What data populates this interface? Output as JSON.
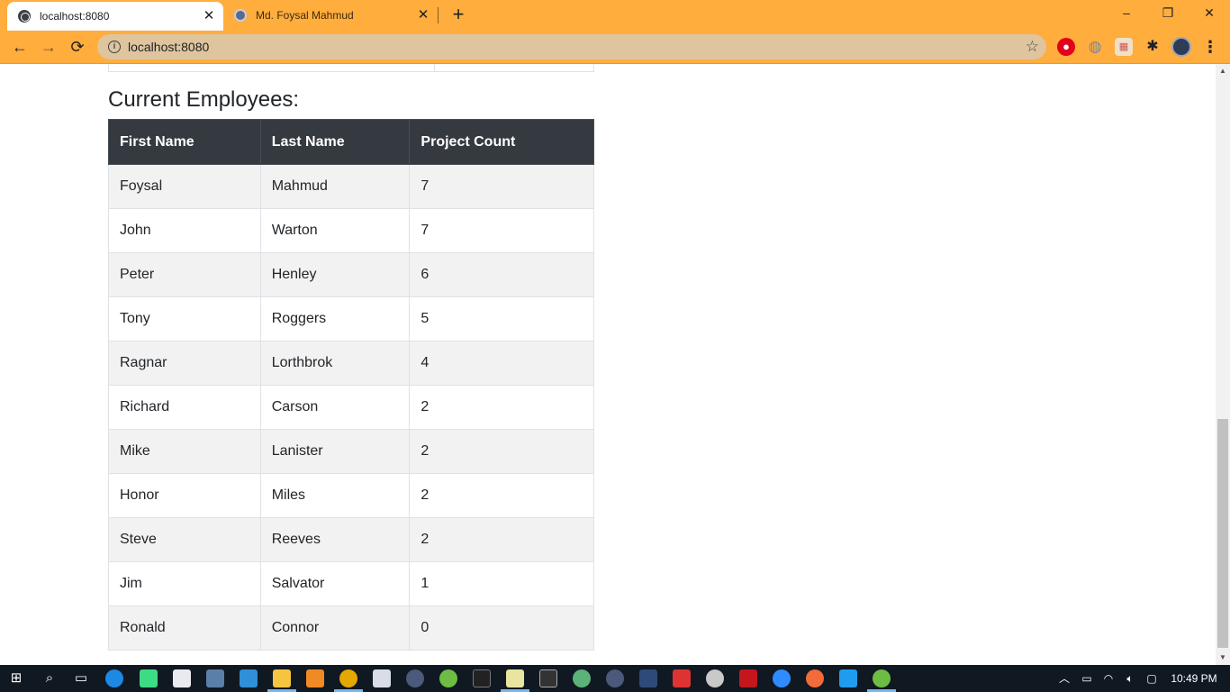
{
  "browser": {
    "tabs": [
      {
        "title": "localhost:8080",
        "active": true
      },
      {
        "title": "Md. Foysal Mahmud",
        "active": false
      }
    ],
    "address": "localhost:8080",
    "window_controls": {
      "minimize": "–",
      "restore": "❐",
      "close": "✕"
    },
    "nav": {
      "back": "←",
      "forward": "→",
      "reload": "⟳"
    }
  },
  "page": {
    "heading": "Current Employees:",
    "table": {
      "headers": [
        "First Name",
        "Last Name",
        "Project Count"
      ],
      "rows": [
        [
          "Foysal",
          "Mahmud",
          "7"
        ],
        [
          "John",
          "Warton",
          "7"
        ],
        [
          "Peter",
          "Henley",
          "6"
        ],
        [
          "Tony",
          "Roggers",
          "5"
        ],
        [
          "Ragnar",
          "Lorthbrok",
          "4"
        ],
        [
          "Richard",
          "Carson",
          "2"
        ],
        [
          "Mike",
          "Lanister",
          "2"
        ],
        [
          "Honor",
          "Miles",
          "2"
        ],
        [
          "Steve",
          "Reeves",
          "2"
        ],
        [
          "Jim",
          "Salvator",
          "1"
        ],
        [
          "Ronald",
          "Connor",
          "0"
        ]
      ]
    }
  },
  "taskbar": {
    "clock": "10:49 PM",
    "colors": {
      "background": "#101822",
      "accent": "#ffad3d"
    }
  }
}
